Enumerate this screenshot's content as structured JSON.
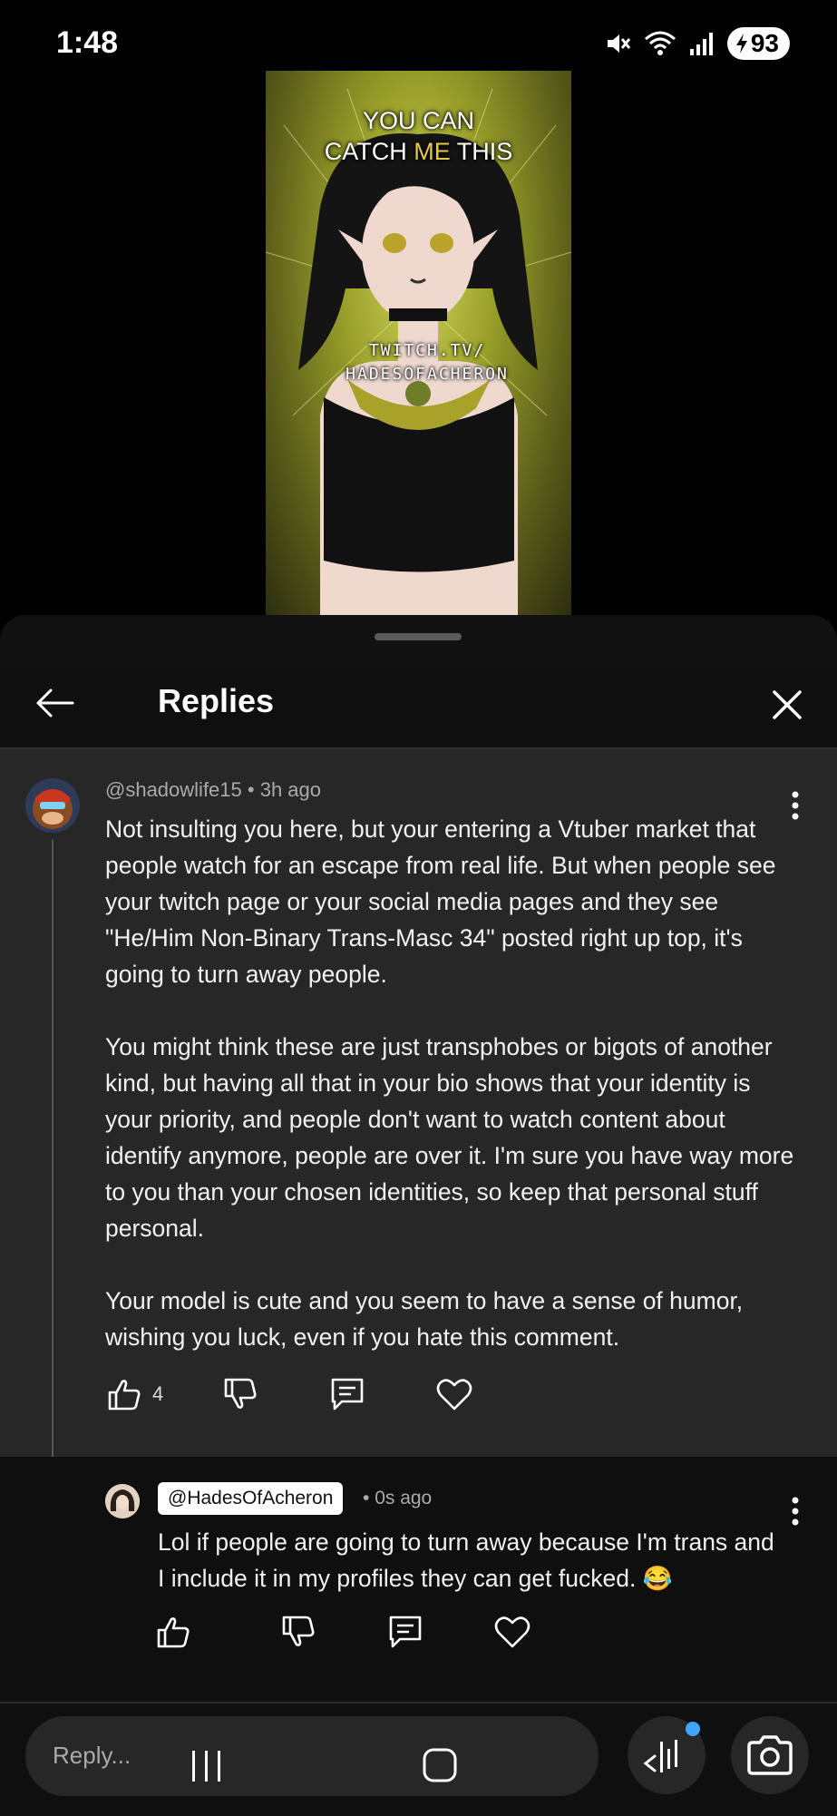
{
  "status_bar": {
    "time": "1:48",
    "battery": "93",
    "icons": [
      "mute-icon",
      "wifi-icon",
      "signal-icon",
      "charging-icon"
    ]
  },
  "video": {
    "caption_line1": "YOU CAN",
    "caption_line2_pre": "CATCH ",
    "caption_line2_hl": "ME",
    "caption_line2_post": " THIS",
    "twitch_line1": "TWITCH.TV/",
    "twitch_line2": "HADESOFACHERON"
  },
  "header": {
    "title": "Replies"
  },
  "comment": {
    "author": "@shadowlife15",
    "time": "3h ago",
    "paragraphs": [
      "Not insulting you here, but your entering a Vtuber market that people watch for an escape from real life. But when people see your twitch page or your social media pages and they see \"He/Him Non-Binary Trans-Masc 34\" posted right up top, it's going to turn away people.",
      "You might think these are just transphobes or bigots of another kind, but having all that in your bio shows that your identity is your priority, and people don't want to watch content about identify anymore, people are over it. I'm sure you have way more to you than your chosen identities, so keep that personal stuff personal.",
      "Your model is cute and you seem to have a sense of humor, wishing you luck, even if you hate this comment."
    ],
    "likes": "4"
  },
  "reply": {
    "author": "@HadesOfAcheron",
    "time": "0s ago",
    "text": "Lol if people are going to turn away because I'm trans and I include it in my profiles they can get fucked. 😂"
  },
  "bottom_bar": {
    "placeholder": "Reply..."
  },
  "colors": {
    "sheet": "#0f0f0f",
    "comment_bg": "#272727",
    "accent_dot": "#3ea6ff"
  }
}
